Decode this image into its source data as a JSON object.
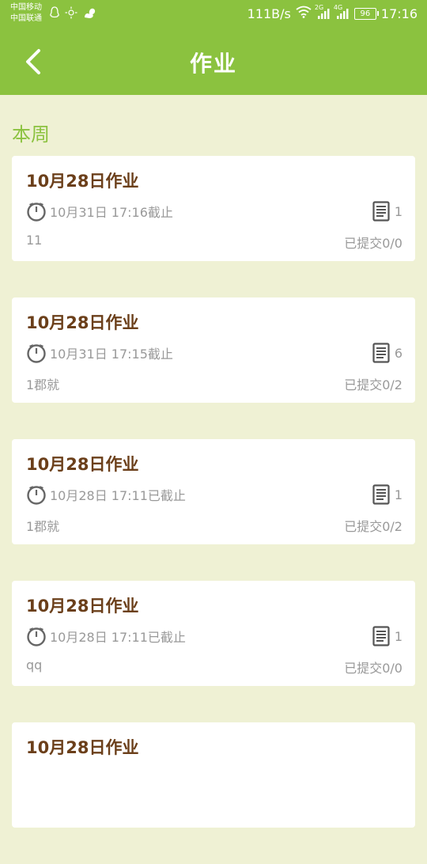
{
  "statusbar": {
    "carrier_1": "中国移动",
    "carrier_2": "中国联通",
    "net_speed": "111B/s",
    "signal_1_label": "2G",
    "signal_2_label": "4G",
    "battery": "96",
    "time": "17:16"
  },
  "header": {
    "title": "作业",
    "color": "#8bc23f"
  },
  "section": {
    "title": "本周"
  },
  "homeworks": [
    {
      "title": "10月28日作业",
      "deadline": "10月31日 17:16截止",
      "count": "1",
      "desc": "11",
      "submitted": "已提交0/0"
    },
    {
      "title": "10月28日作业",
      "deadline": "10月31日 17:15截止",
      "count": "6",
      "desc": "1郡就",
      "submitted": "已提交0/2"
    },
    {
      "title": "10月28日作业",
      "deadline": "10月28日 17:11已截止",
      "count": "1",
      "desc": "1郡就",
      "submitted": "已提交0/2"
    },
    {
      "title": "10月28日作业",
      "deadline": "10月28日 17:11已截止",
      "count": "1",
      "desc": "qq",
      "submitted": "已提交0/0"
    },
    {
      "title": "10月28日作业",
      "deadline": "",
      "count": "",
      "desc": "",
      "submitted": ""
    }
  ]
}
